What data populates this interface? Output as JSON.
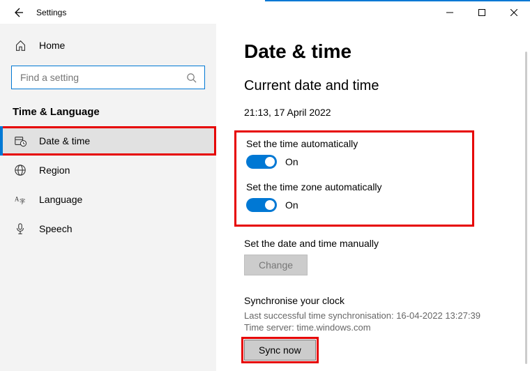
{
  "titlebar": {
    "title": "Settings"
  },
  "sidebar": {
    "home": "Home",
    "searchPlaceholder": "Find a setting",
    "section": "Time & Language",
    "items": [
      {
        "label": "Date & time"
      },
      {
        "label": "Region"
      },
      {
        "label": "Language"
      },
      {
        "label": "Speech"
      }
    ]
  },
  "main": {
    "title": "Date & time",
    "subtitle": "Current date and time",
    "currentDateTime": "21:13, 17 April 2022",
    "autoTimeLabel": "Set the time automatically",
    "autoTimeState": "On",
    "autoZoneLabel": "Set the time zone automatically",
    "autoZoneState": "On",
    "manualLabel": "Set the date and time manually",
    "changeBtn": "Change",
    "syncHeader": "Synchronise your clock",
    "lastSync": "Last successful time synchronisation: 16-04-2022 13:27:39",
    "timeServer": "Time server: time.windows.com",
    "syncBtn": "Sync now"
  }
}
